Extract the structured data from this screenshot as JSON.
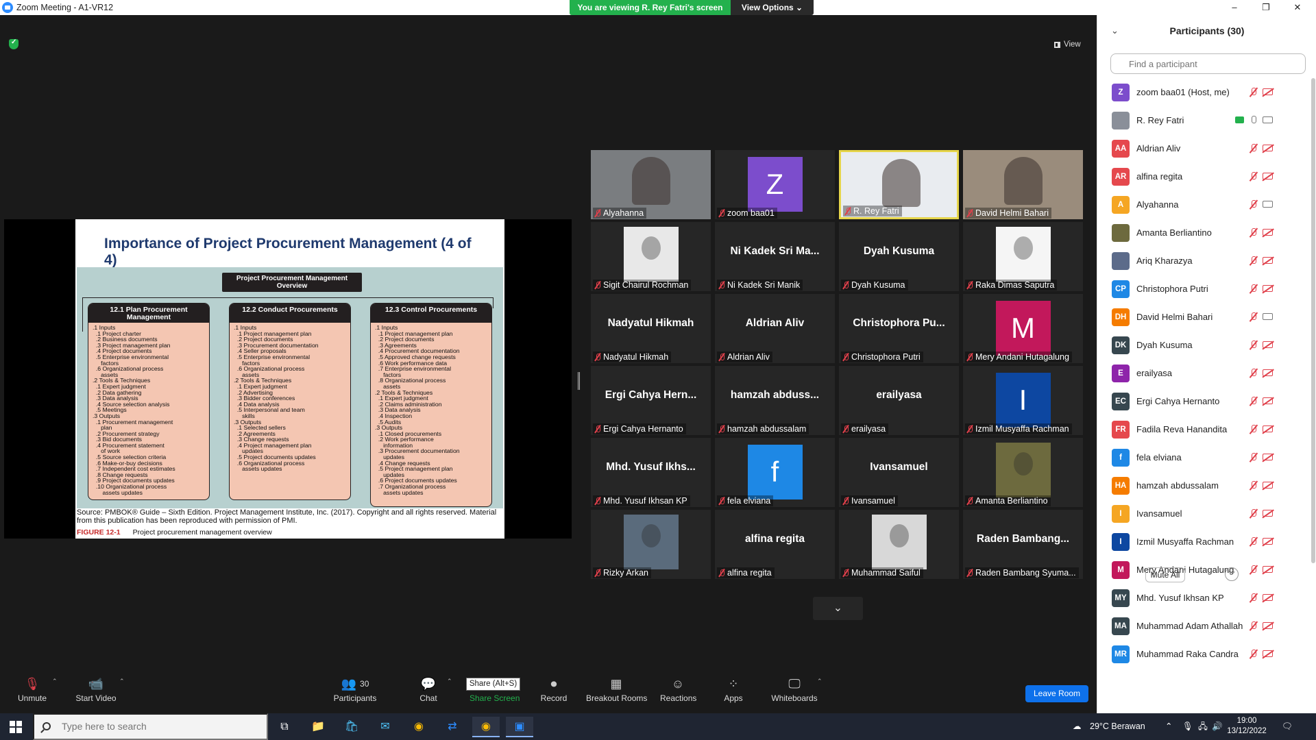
{
  "window": {
    "title": "Zoom Meeting - A1-VR12",
    "min": "–",
    "max": "❐",
    "close": "✕"
  },
  "banner": {
    "viewing": "You are viewing R. Rey Fatri's screen",
    "view_options": "View Options ⌄"
  },
  "view_button": {
    "label": "View"
  },
  "slide": {
    "title": "Importance of Project Procurement Management (4 of 4)",
    "overview": "Project Procurement Management Overview",
    "processes": [
      {
        "header": "12.1 Plan Procurement Management",
        "body": ".1 Inputs\n  .1 Project charter\n  .2 Business documents\n  .3 Project management plan\n  .4 Project documents\n  .5 Enterprise environmental\n     factors\n  .6 Organizational process\n     assets\n.2 Tools & Techniques\n  .1 Expert judgment\n  .2 Data gathering\n  .3 Data analysis\n  .4 Source selection analysis\n  .5 Meetings\n.3 Outputs\n  .1 Procurement management\n     plan\n  .2 Procurement strategy\n  .3 Bid documents\n  .4 Procurement statement\n     of work\n  .5 Source selection criteria\n  .6 Make-or-buy decisions\n  .7 Independent cost estimates\n  .8 Change requests\n  .9 Project documents updates\n  .10 Organizational process\n      assets updates"
      },
      {
        "header": "12.2 Conduct Procurements",
        "body": ".1 Inputs\n  .1 Project management plan\n  .2 Project documents\n  .3 Procurement documentation\n  .4 Seller proposals\n  .5 Enterprise environmental\n     factors\n  .6 Organizational process\n     assets\n.2 Tools & Techniques\n  .1 Expert judgment\n  .2 Advertising\n  .3 Bidder conferences\n  .4 Data analysis\n  .5 Interpersonal and team\n     skills\n.3 Outputs\n  .1 Selected sellers\n  .2 Agreements\n  .3 Change requests\n  .4 Project management plan\n     updates\n  .5 Project documents updates\n  .6 Organizational process\n     assets updates"
      },
      {
        "header": "12.3 Control Procurements",
        "body": ".1 Inputs\n  .1 Project management plan\n  .2 Project documents\n  .3 Agreements\n  .4 Procurement documentation\n  .5 Approved change requests\n  .6 Work performance data\n  .7 Enterprise environmental\n     factors\n  .8 Organizational process\n     assets\n.2 Tools & Techniques\n  .1 Expert judgment\n  .2 Claims administration\n  .3 Data analysis\n  .4 Inspection\n  .5 Audits\n.3 Outputs\n  .1 Closed procurements\n  .2 Work performance\n     information\n  .3 Procurement documentation\n     updates\n  .4 Change requests\n  .5 Project management plan\n     updates\n  .6 Project documents updates\n  .7 Organizational process\n     assets updates"
      }
    ],
    "source": "Source: PMBOK® Guide – Sixth Edition. Project Management Institute, Inc. (2017). Copyright and all rights reserved. Material from this publication has been reproduced with permission of PMI.",
    "figure_label": "FIGURE 12-1",
    "figure_caption": "Project procurement management overview"
  },
  "tiles": [
    {
      "label": "Alyahanna",
      "kind": "photo",
      "bg": "#7a7d80"
    },
    {
      "label": "zoom baa01",
      "kind": "letter",
      "letter": "Z",
      "color": "#7c4dcc"
    },
    {
      "label": "R. Rey Fatri",
      "kind": "photo",
      "bg": "#e9ecf0",
      "active": true
    },
    {
      "label": "David Helmi Bahari",
      "kind": "photo",
      "bg": "#9a8c7c"
    },
    {
      "label": "Sigit Chairul Rochman",
      "kind": "photo-small",
      "bg": "#e8e8e8"
    },
    {
      "label": "Ni Kadek Sri Manik",
      "kind": "name",
      "big": "Ni Kadek Sri Ma..."
    },
    {
      "label": "Dyah Kusuma",
      "kind": "name",
      "big": "Dyah Kusuma"
    },
    {
      "label": "Raka Dimas Saputra",
      "kind": "photo-small",
      "bg": "#f5f5f5"
    },
    {
      "label": "Nadyatul Hikmah",
      "kind": "name",
      "big": "Nadyatul Hikmah"
    },
    {
      "label": "Aldrian Aliv",
      "kind": "name",
      "big": "Aldrian Aliv"
    },
    {
      "label": "Christophora Putri",
      "kind": "name",
      "big": "Christophora  Pu..."
    },
    {
      "label": "Mery Andani Hutagalung",
      "kind": "letter",
      "letter": "M",
      "color": "#c2185b"
    },
    {
      "label": "Ergi Cahya Hernanto",
      "kind": "name",
      "big": "Ergi Cahya Hern..."
    },
    {
      "label": "hamzah abdussalam",
      "kind": "name",
      "big": "hamzah  abduss..."
    },
    {
      "label": "erailyasa",
      "kind": "name",
      "big": "erailyasa"
    },
    {
      "label": "Izmil Musyaffa Rachman",
      "kind": "letter",
      "letter": "I",
      "color": "#0d47a1"
    },
    {
      "label": "Mhd. Yusuf Ikhsan KP",
      "kind": "name",
      "big": "Mhd.  Yusuf  Ikhs..."
    },
    {
      "label": "fela elviana",
      "kind": "letter",
      "letter": "f",
      "color": "#1e88e5"
    },
    {
      "label": "Ivansamuel",
      "kind": "name",
      "big": "Ivansamuel"
    },
    {
      "label": "Amanta Berliantino",
      "kind": "photo-small",
      "bg": "#6d6a3e"
    },
    {
      "label": "Rizky Arkan",
      "kind": "photo-small",
      "bg": "#5a6b7c"
    },
    {
      "label": "alfina regita",
      "kind": "name",
      "big": "alfina regita"
    },
    {
      "label": "Muhammad Saiful",
      "kind": "photo-small",
      "bg": "#d8d8d8"
    },
    {
      "label": "Raden Bambang Syuma...",
      "kind": "name",
      "big": "Raden  Bambang..."
    }
  ],
  "participants_panel": {
    "title": "Participants (30)",
    "search_placeholder": "Find a participant",
    "mute_all": "Mute All",
    "more": "···",
    "items": [
      {
        "initials": "Z",
        "name": "zoom baa01 (Host, me)",
        "color": "#7c4dcc",
        "mic": "off",
        "cam": "off"
      },
      {
        "initials": "",
        "name": "R. Rey Fatri",
        "color": "#8a8f99",
        "mic": "on",
        "cam": "on",
        "sharing": true
      },
      {
        "initials": "AA",
        "name": "Aldrian Aliv",
        "color": "#e5484d",
        "mic": "off",
        "cam": "off"
      },
      {
        "initials": "AR",
        "name": "alfina regita",
        "color": "#e5484d",
        "mic": "off",
        "cam": "off"
      },
      {
        "initials": "A",
        "name": "Alyahanna",
        "color": "#f5a623",
        "mic": "off",
        "cam": "on"
      },
      {
        "initials": "",
        "name": "Amanta Berliantino",
        "color": "#6d6a3e",
        "mic": "off",
        "cam": "off"
      },
      {
        "initials": "",
        "name": "Ariq Kharazya",
        "color": "#5c6b8a",
        "mic": "off",
        "cam": "off"
      },
      {
        "initials": "CP",
        "name": "Christophora Putri",
        "color": "#1e88e5",
        "mic": "off",
        "cam": "off"
      },
      {
        "initials": "DH",
        "name": "David Helmi Bahari",
        "color": "#f57c00",
        "mic": "off",
        "cam": "on"
      },
      {
        "initials": "DK",
        "name": "Dyah Kusuma",
        "color": "#37474f",
        "mic": "off",
        "cam": "off"
      },
      {
        "initials": "E",
        "name": "erailyasa",
        "color": "#8e24aa",
        "mic": "off",
        "cam": "off"
      },
      {
        "initials": "EC",
        "name": "Ergi Cahya Hernanto",
        "color": "#37474f",
        "mic": "off",
        "cam": "off"
      },
      {
        "initials": "FR",
        "name": "Fadila Reva Hanandita",
        "color": "#e5484d",
        "mic": "off",
        "cam": "off"
      },
      {
        "initials": "f",
        "name": "fela elviana",
        "color": "#1e88e5",
        "mic": "off",
        "cam": "off"
      },
      {
        "initials": "HA",
        "name": "hamzah abdussalam",
        "color": "#f57c00",
        "mic": "off",
        "cam": "off"
      },
      {
        "initials": "I",
        "name": "Ivansamuel",
        "color": "#f5a623",
        "mic": "off",
        "cam": "off"
      },
      {
        "initials": "I",
        "name": "Izmil Musyaffa Rachman",
        "color": "#0d47a1",
        "mic": "off",
        "cam": "off"
      },
      {
        "initials": "M",
        "name": "Mery Andani Hutagalung",
        "color": "#c2185b",
        "mic": "off",
        "cam": "off"
      },
      {
        "initials": "MY",
        "name": "Mhd. Yusuf Ikhsan KP",
        "color": "#37474f",
        "mic": "off",
        "cam": "off"
      },
      {
        "initials": "MA",
        "name": "Muhammad Adam Athallah",
        "color": "#37474f",
        "mic": "off",
        "cam": "off"
      },
      {
        "initials": "MR",
        "name": "Muhammad Raka Candra",
        "color": "#1e88e5",
        "mic": "off",
        "cam": "off"
      }
    ]
  },
  "toolbar": {
    "unmute": "Unmute",
    "start_video": "Start Video",
    "participants": "Participants",
    "participants_count": "30",
    "chat": "Chat",
    "share_screen": "Share Screen",
    "share_tooltip": "Share (Alt+S)",
    "record": "Record",
    "breakout": "Breakout Rooms",
    "reactions": "Reactions",
    "apps": "Apps",
    "whiteboards": "Whiteboards",
    "leave": "Leave Room"
  },
  "taskbar": {
    "search_placeholder": "Type here to search",
    "weather": "29°C  Berawan",
    "time": "19:00",
    "date": "13/12/2022"
  }
}
